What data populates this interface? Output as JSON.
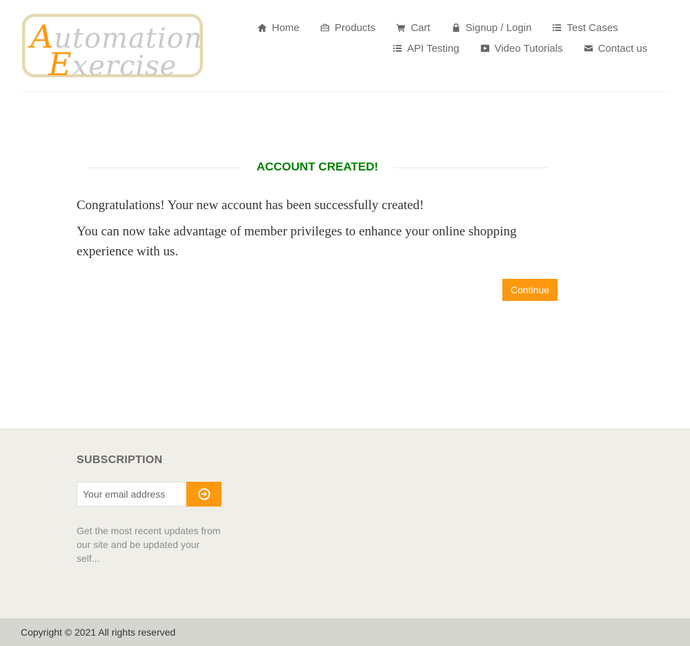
{
  "logo": {
    "cap1": "A",
    "rest1": "utomation",
    "cap2": "E",
    "rest2": "xercise"
  },
  "nav": {
    "row1": [
      {
        "label": "Home",
        "icon": "home-icon"
      },
      {
        "label": "Products",
        "icon": "briefcase-icon"
      },
      {
        "label": "Cart",
        "icon": "cart-icon"
      },
      {
        "label": "Signup / Login",
        "icon": "lock-icon"
      },
      {
        "label": "Test Cases",
        "icon": "list-icon"
      }
    ],
    "row2": [
      {
        "label": "API Testing",
        "icon": "list-icon"
      },
      {
        "label": "Video Tutorials",
        "icon": "youtube-play-icon"
      },
      {
        "label": "Contact us",
        "icon": "envelope-icon"
      }
    ]
  },
  "main": {
    "title": "ACCOUNT CREATED!",
    "message1": "Congratulations! Your new account has been successfully created!",
    "message2": "You can now take advantage of member privileges to enhance your online shopping experience with us.",
    "continue_label": "Continue"
  },
  "footer": {
    "subscription_title": "SUBSCRIPTION",
    "email_placeholder": "Your email address",
    "subscribe_icon": "arrow-circle-right-icon",
    "description": "Get the most recent updates from our site and be updated your self...",
    "copyright": "Copyright © 2021 All rights reserved"
  },
  "colors": {
    "accent": "#fe980f",
    "success": "#008000",
    "footer_bg": "#efeee8",
    "footer_bottom_bg": "#d6d6d0"
  }
}
